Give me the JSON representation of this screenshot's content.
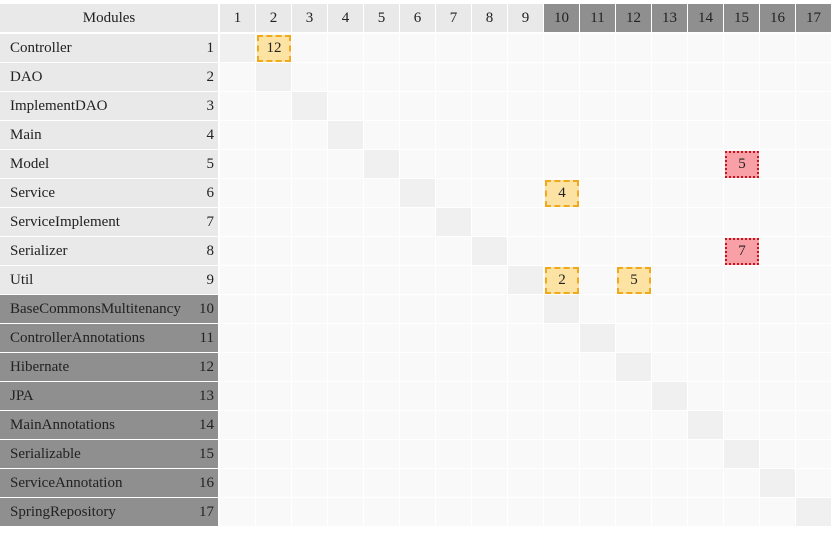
{
  "corner_label": "Modules",
  "modules": [
    {
      "name": "Controller",
      "index": "1",
      "group": "light"
    },
    {
      "name": "DAO",
      "index": "2",
      "group": "light"
    },
    {
      "name": "ImplementDAO",
      "index": "3",
      "group": "light"
    },
    {
      "name": "Main",
      "index": "4",
      "group": "light"
    },
    {
      "name": "Model",
      "index": "5",
      "group": "light"
    },
    {
      "name": "Service",
      "index": "6",
      "group": "light"
    },
    {
      "name": "ServiceImplement",
      "index": "7",
      "group": "light"
    },
    {
      "name": "Serializer",
      "index": "8",
      "group": "light"
    },
    {
      "name": "Util",
      "index": "9",
      "group": "light"
    },
    {
      "name": "BaseCommonsMultitenancy",
      "index": "10",
      "group": "dark"
    },
    {
      "name": "ControllerAnnotations",
      "index": "11",
      "group": "dark"
    },
    {
      "name": "Hibernate",
      "index": "12",
      "group": "dark"
    },
    {
      "name": "JPA",
      "index": "13",
      "group": "dark"
    },
    {
      "name": "MainAnnotations",
      "index": "14",
      "group": "dark"
    },
    {
      "name": "Serializable",
      "index": "15",
      "group": "dark"
    },
    {
      "name": "ServiceAnnotation",
      "index": "16",
      "group": "dark"
    },
    {
      "name": "SpringRepository",
      "index": "17",
      "group": "dark"
    }
  ],
  "dependencies": [
    {
      "row": 1,
      "col": 2,
      "value": "12",
      "kind": "weak"
    },
    {
      "row": 5,
      "col": 15,
      "value": "5",
      "kind": "strong"
    },
    {
      "row": 6,
      "col": 10,
      "value": "4",
      "kind": "weak"
    },
    {
      "row": 8,
      "col": 15,
      "value": "7",
      "kind": "strong"
    },
    {
      "row": 9,
      "col": 10,
      "value": "2",
      "kind": "weak"
    },
    {
      "row": 9,
      "col": 12,
      "value": "5",
      "kind": "weak"
    }
  ],
  "colors": {
    "light_header": "#e9e9e9",
    "dark_header": "#8f8f8f",
    "cell": "#f9f9f9",
    "diagonal": "#f0f0f0",
    "weak_fill": "#fde3a3",
    "weak_border": "#f0a81c",
    "strong_fill": "#f9a0a6",
    "strong_border": "#c4141e"
  }
}
